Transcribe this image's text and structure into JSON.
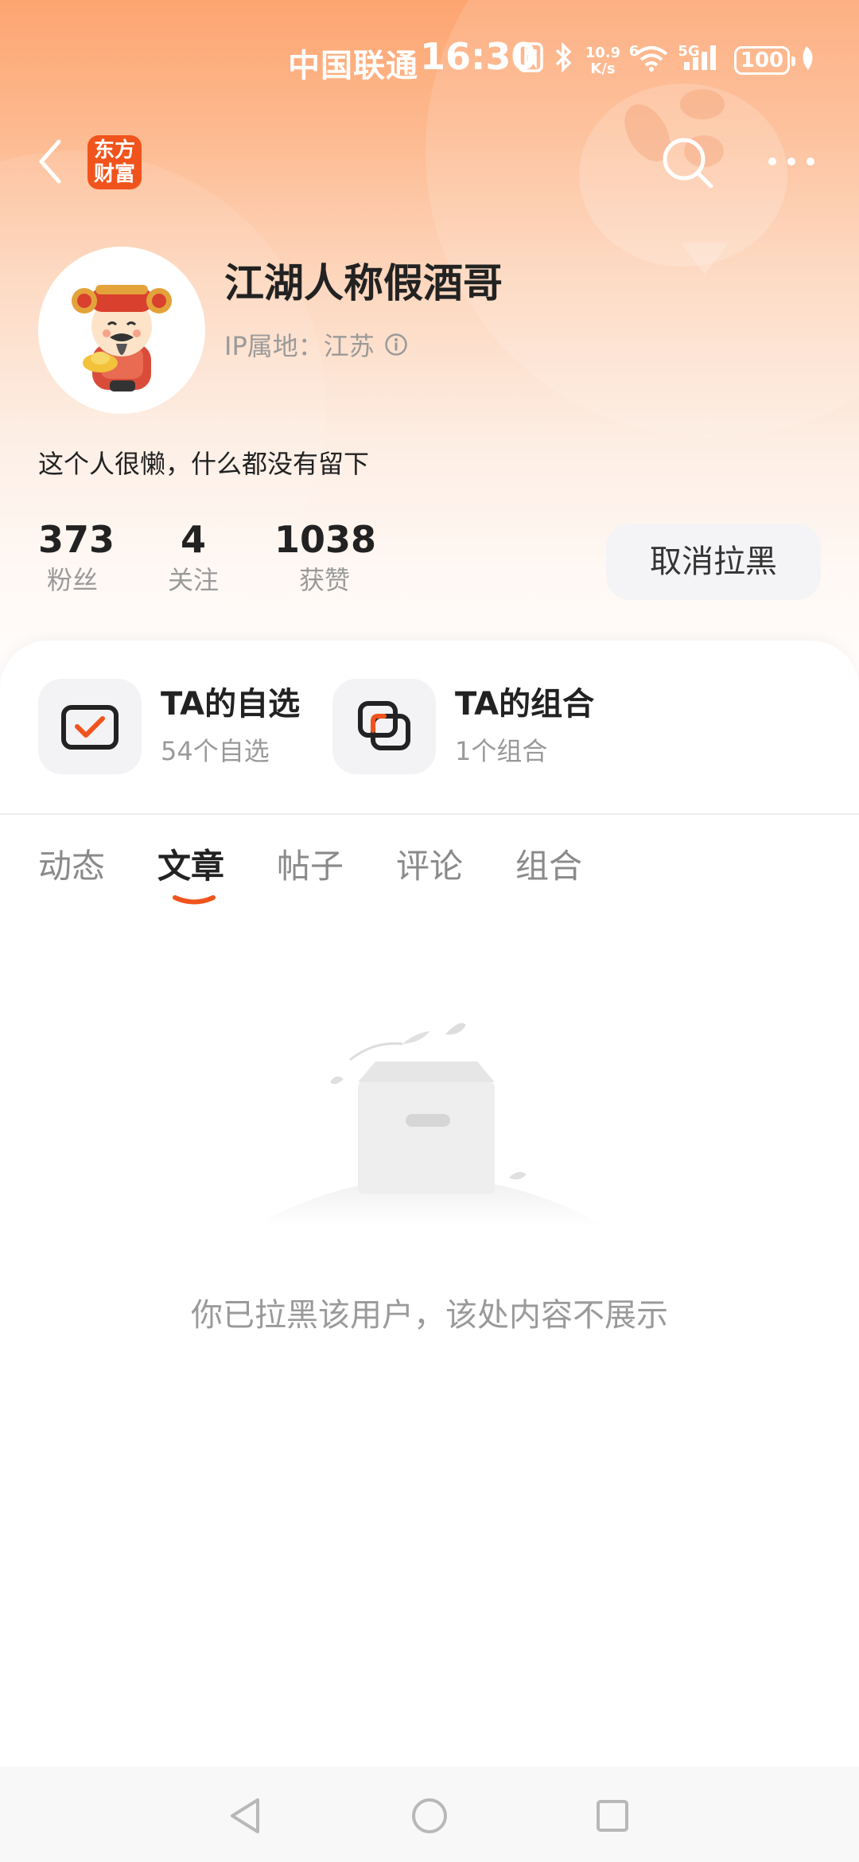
{
  "status_bar": {
    "carrier": "中国联通",
    "time": "16:30",
    "network_speed_value": "10.9",
    "network_speed_unit": "K/s",
    "wifi_tag": "6",
    "cell_tag": "5G",
    "battery": "100"
  },
  "nav": {
    "logo_line1": "东方",
    "logo_line2": "财富"
  },
  "profile": {
    "username": "江湖人称假酒哥",
    "ip_location": "IP属地：江苏",
    "bio": "这个人很懒，什么都没有留下",
    "stats": [
      {
        "value": "373",
        "label": "粉丝"
      },
      {
        "value": "4",
        "label": "关注"
      },
      {
        "value": "1038",
        "label": "获赞"
      }
    ],
    "unblock_label": "取消拉黑"
  },
  "features": [
    {
      "title": "TA的自选",
      "subtitle": "54个自选",
      "icon": "checkbox-icon"
    },
    {
      "title": "TA的组合",
      "subtitle": "1个组合",
      "icon": "portfolio-icon"
    }
  ],
  "tabs": [
    {
      "label": "动态",
      "active": false
    },
    {
      "label": "文章",
      "active": true
    },
    {
      "label": "帖子",
      "active": false
    },
    {
      "label": "评论",
      "active": false
    },
    {
      "label": "组合",
      "active": false
    }
  ],
  "empty_state": {
    "message": "你已拉黑该用户，该处内容不展示"
  },
  "colors": {
    "accent": "#f0541c",
    "header_gradient_top": "#fda571",
    "muted_text": "#9a9a9a"
  }
}
